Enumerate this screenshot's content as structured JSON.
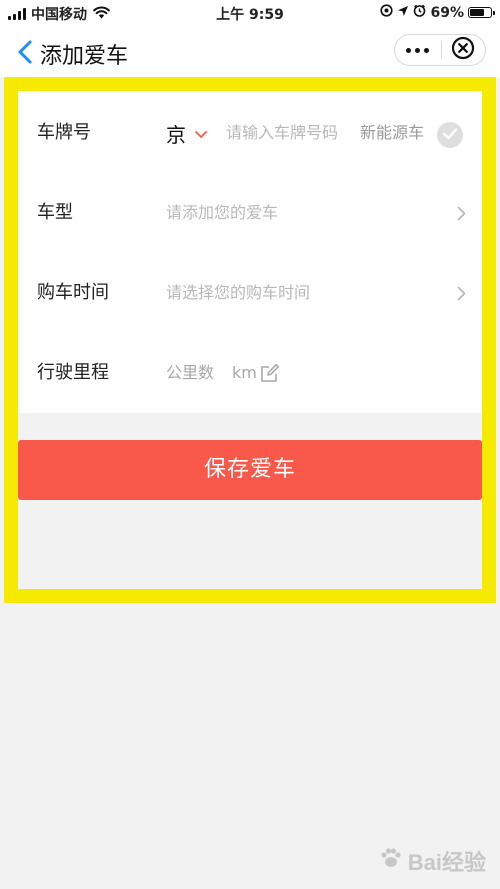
{
  "status_bar": {
    "carrier": "中国移动",
    "time": "上午 9:59",
    "battery_percent": "69%",
    "battery_level": 0.69
  },
  "nav": {
    "back_icon": "chevron-left-icon",
    "title": "添加爱车",
    "more_icon": "more-dots-icon",
    "close_icon": "close-circle-icon"
  },
  "form": {
    "plate": {
      "label": "车牌号",
      "province": "京",
      "placeholder": "请输入车牌号码",
      "new_energy_label": "新能源车"
    },
    "model": {
      "label": "车型",
      "placeholder": "请添加您的爱车"
    },
    "purchase_time": {
      "label": "购车时间",
      "placeholder": "请选择您的购车时间"
    },
    "mileage": {
      "label": "行驶里程",
      "placeholder": "公里数",
      "unit": "km"
    }
  },
  "save_button": {
    "label": "保存爱车"
  },
  "watermark": {
    "text": "Bai经验"
  },
  "colors": {
    "accent": "#f9594b",
    "highlight_frame": "#f6ea00",
    "back_arrow": "#1a8cff",
    "background": "#f2f2f2"
  }
}
